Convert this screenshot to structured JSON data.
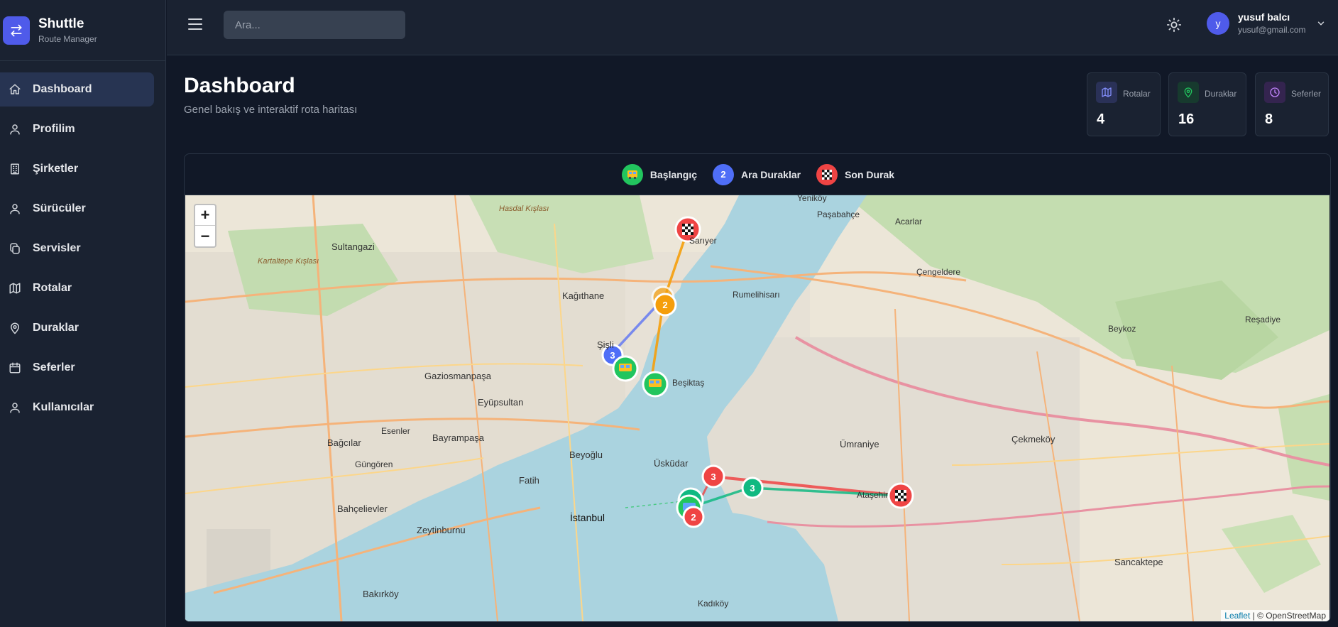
{
  "brand": {
    "title": "Shuttle",
    "subtitle": "Route Manager"
  },
  "sidebar": {
    "items": [
      {
        "label": "Dashboard",
        "icon": "home-icon",
        "active": true
      },
      {
        "label": "Profilim",
        "icon": "user-icon"
      },
      {
        "label": "Şirketler",
        "icon": "building-icon"
      },
      {
        "label": "Sürücüler",
        "icon": "user-icon"
      },
      {
        "label": "Servisler",
        "icon": "copy-icon"
      },
      {
        "label": "Rotalar",
        "icon": "map-icon"
      },
      {
        "label": "Duraklar",
        "icon": "map-pin-icon"
      },
      {
        "label": "Seferler",
        "icon": "calendar-icon"
      },
      {
        "label": "Kullanıcılar",
        "icon": "user-icon"
      }
    ]
  },
  "header": {
    "search_placeholder": "Ara...",
    "user": {
      "initial": "y",
      "name": "yusuf balcı",
      "email": "yusuf@gmail.com"
    }
  },
  "page": {
    "title": "Dashboard",
    "subtitle": "Genel bakış ve interaktif rota haritası"
  },
  "stats": [
    {
      "label": "Rotalar",
      "value": "4",
      "icon": "map-icon",
      "color": "#6366f1"
    },
    {
      "label": "Duraklar",
      "value": "16",
      "icon": "map-pin-icon",
      "color": "#22c55e"
    },
    {
      "label": "Seferler",
      "value": "8",
      "icon": "clock-icon",
      "color": "#a855f7"
    }
  ],
  "legend": [
    {
      "label": "Başlangıç",
      "marker": "bus-icon",
      "color": "#22c55e"
    },
    {
      "label": "Ara Duraklar",
      "marker": "2",
      "color": "#4f6ef7"
    },
    {
      "label": "Son Durak",
      "marker": "checkered-flag-icon",
      "color": "#ef4444"
    }
  ],
  "map": {
    "zoom_in": "+",
    "zoom_out": "−",
    "attribution_link": "Leaflet",
    "attribution_text": " | © OpenStreetMap",
    "labels": {
      "l1": "Sultangazi",
      "l2": "Gaziosmanpaşa",
      "l3": "Eyüpsultan",
      "l4": "Bayrampaşa",
      "l5": "Bağcılar",
      "l6": "Esenler",
      "l7": "Güngören",
      "l8": "Bahçelievler",
      "l9": "Zeytinburnu",
      "l10": "Bakırköy",
      "l11": "Fatih",
      "l12": "İstanbul",
      "l13": "Beyoğlu",
      "l14": "Şişli",
      "l15": "Kağıthane",
      "l16": "Üsküdar",
      "l17": "Ümraniye",
      "l18": "Çekmeköy",
      "l19": "Sancaktepe",
      "l20": "Ataşehir",
      "l21": "Kadıköy",
      "l22": "Beşiktaş",
      "l23": "Sarıyer",
      "l24": "Beykoz",
      "l25": "Reşadiye",
      "l26": "Yeniköy",
      "l27": "Çengeldere",
      "l28": "Rumelihisarı",
      "l29": "Kartaltepe Kışlası",
      "l30": "Hasdal Kışlası",
      "l31": "Paşabahçe",
      "l32": "Acarlar"
    }
  },
  "colors": {
    "accent": "#4f5bea",
    "start": "#22c55e",
    "mid": "#4f6ef7",
    "end": "#ef4444",
    "orange": "#f59e0b"
  }
}
